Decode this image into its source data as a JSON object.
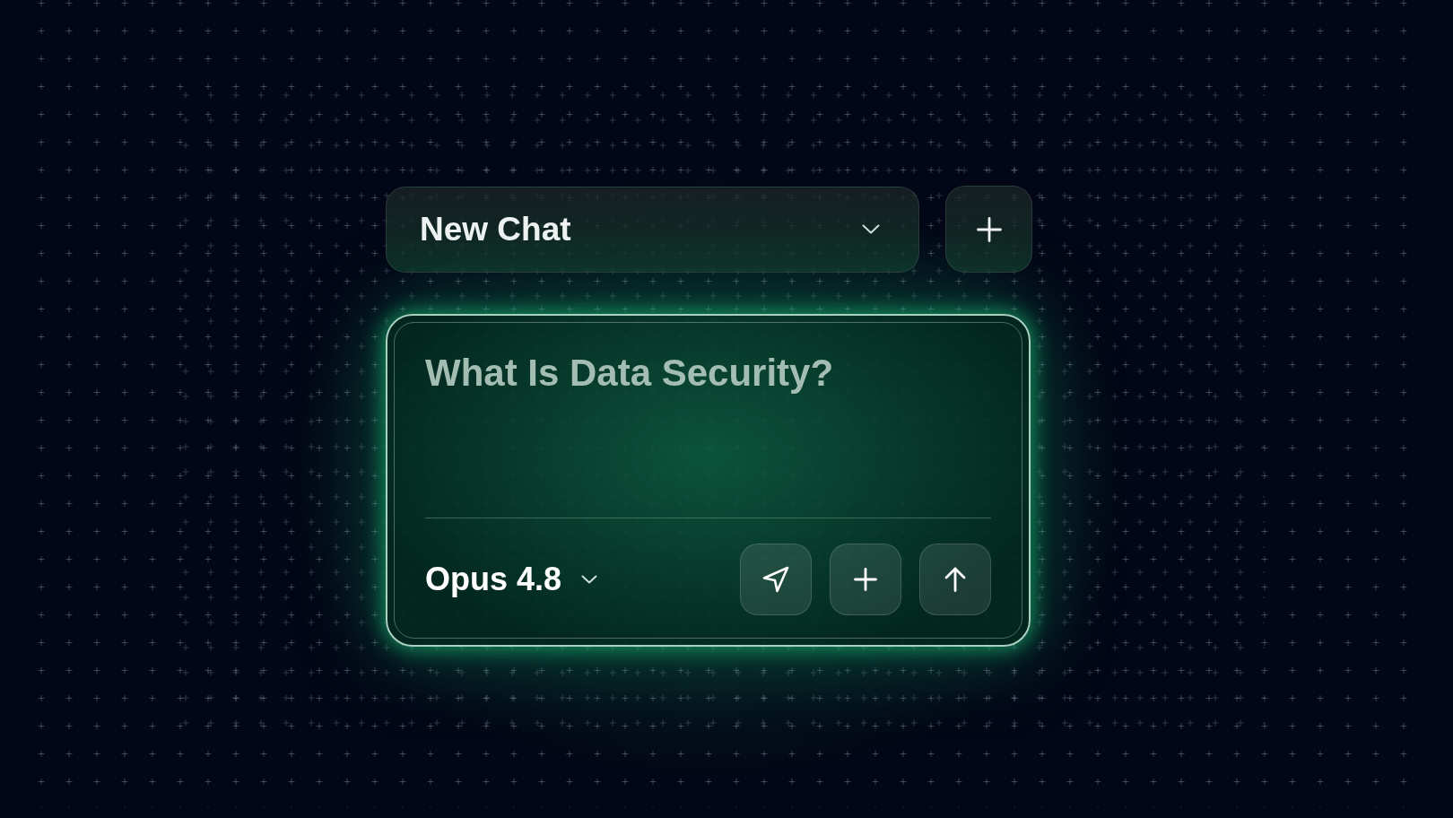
{
  "chat_selector": {
    "title": "New Chat"
  },
  "composer": {
    "placeholder": "What Is Data Security?",
    "model": "Opus 4.8"
  }
}
